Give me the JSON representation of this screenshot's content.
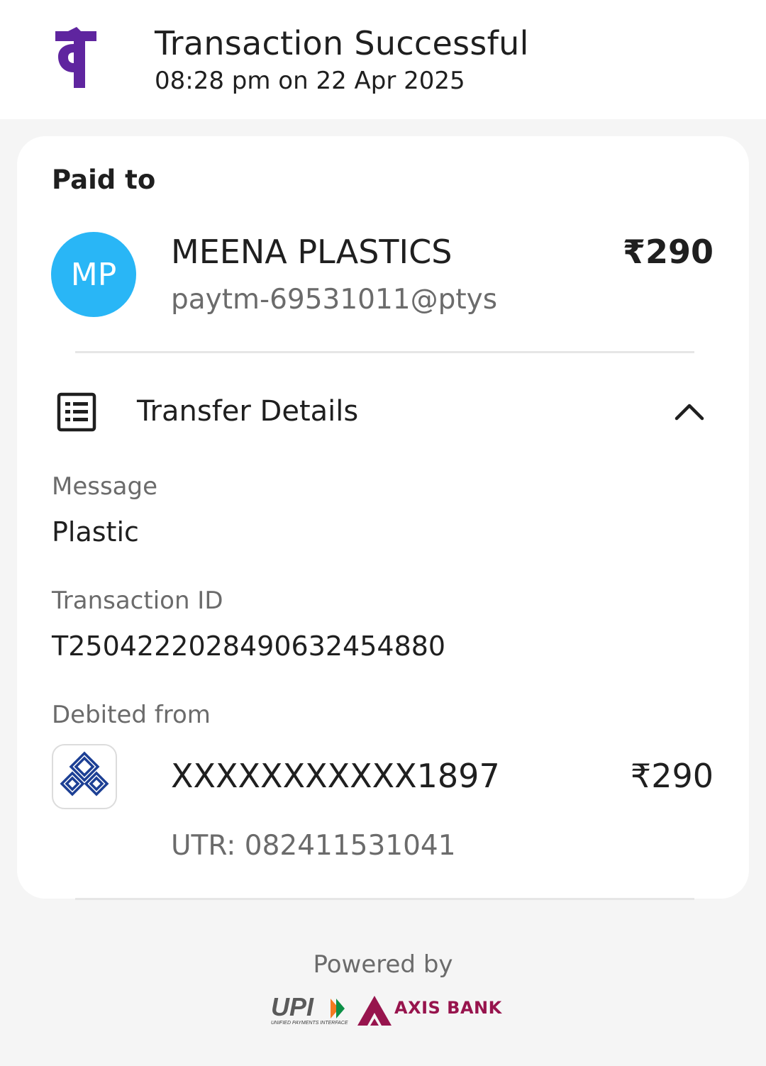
{
  "header": {
    "title": "Transaction Successful",
    "datetime": "08:28 pm on 22 Apr 2025",
    "logo": "phonepe-logo",
    "brand_color": "#5f259f"
  },
  "payee": {
    "section_label": "Paid to",
    "avatar_initials": "MP",
    "avatar_color": "#29b6f6",
    "name": "MEENA PLASTICS",
    "upi_id": "paytm-69531011@ptys",
    "amount": "₹290"
  },
  "transfer_details": {
    "title": "Transfer Details",
    "icon": "receipt-list-icon",
    "toggle_icon": "chevron-up-icon",
    "message_label": "Message",
    "message_value": "Plastic",
    "transaction_id_label": "Transaction ID",
    "transaction_id_value": "T2504222028490632454880",
    "debited_from_label": "Debited from",
    "bank_icon": "bank-of-india-logo",
    "account_number": "XXXXXXXXXXX1897",
    "debit_amount": "₹290",
    "utr": "UTR: 082411531041"
  },
  "footer": {
    "powered_by": "Powered by",
    "upi_logo_text": "UPI",
    "upi_tagline": "UNIFIED PAYMENTS INTERFACE",
    "bank_name": "AXIS BANK",
    "bank_color": "#97144d"
  }
}
